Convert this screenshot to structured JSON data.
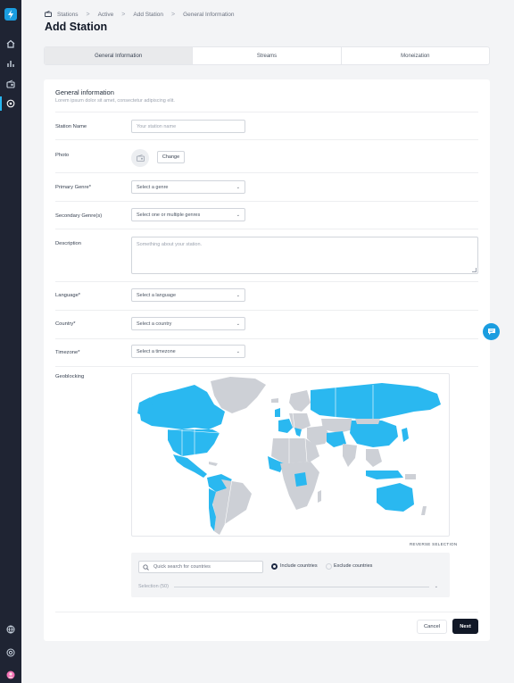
{
  "breadcrumb": {
    "items": [
      "Stations",
      "Active",
      "Add Station",
      "General Information"
    ],
    "separator": ">"
  },
  "page_title": "Add Station",
  "tabs": [
    {
      "label": "General Information",
      "active": true
    },
    {
      "label": "Streams",
      "active": false
    },
    {
      "label": "Moneization",
      "active": false
    }
  ],
  "section": {
    "title": "General information",
    "subtitle": "Lorem ipsum dolor sit amet, consectetur adipiscing elit."
  },
  "form": {
    "station_name": {
      "label": "Station Name",
      "placeholder": "Your station name"
    },
    "photo": {
      "label": "Photo",
      "change_label": "Change"
    },
    "primary_genre": {
      "label": "Primary Genre*",
      "value": "Select a genre"
    },
    "secondary_genre": {
      "label": "Secondary Genre(s)",
      "value": "Select one or multiple genres"
    },
    "description": {
      "label": "Description",
      "placeholder": "Something about your station."
    },
    "language": {
      "label": "Language*",
      "value": "Select a language"
    },
    "country": {
      "label": "Country*",
      "value": "Select a country"
    },
    "timezone": {
      "label": "Timezone*",
      "value": "Select a timezone"
    },
    "geoblocking": {
      "label": "Geoblocking",
      "reverse_label": "REVERSE SELECTION",
      "search_placeholder": "Quick search for countries",
      "include_label": "Include countries",
      "exclude_label": "Exclude countries",
      "include_selected": true,
      "selection_label": "Selection (50)"
    }
  },
  "actions": {
    "cancel": "Cancel",
    "next": "Next"
  },
  "colors": {
    "accent": "#1a9de0",
    "map_selected": "#2ab8f0",
    "map_unselected": "#cdd0d6",
    "sidebar": "#1f2433",
    "primary_button": "#111827"
  },
  "icons": {
    "sidebar": [
      "bolt-icon",
      "home-icon",
      "chart-icon",
      "radio-icon",
      "station-icon",
      "globe-icon",
      "help-icon",
      "avatar-icon"
    ],
    "chat": "chat-icon",
    "search": "search-icon"
  }
}
